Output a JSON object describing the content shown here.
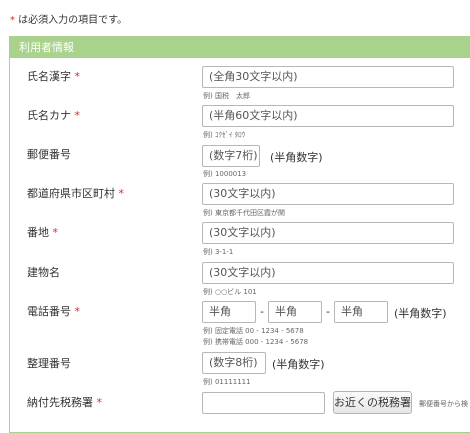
{
  "notice": {
    "asterisk": "*",
    "text": " は必須入力の項目です。"
  },
  "section_title": "利用者情報",
  "required_mark": "*",
  "colors": {
    "header_bg": "#a9d28c",
    "required": "#e0272f"
  },
  "fields": {
    "name_kanji": {
      "label": "氏名漢字",
      "placeholder": "(全角30文字以内)",
      "hint": "例) 国税　太郎"
    },
    "name_kana": {
      "label": "氏名カナ",
      "placeholder": "(半角60文字以内)",
      "hint": "例) ｺｸｾﾞｲ ﾀﾛｳ"
    },
    "postal": {
      "label": "郵便番号",
      "placeholder": "(数字7桁)",
      "suffix": "(半角数字)",
      "hint": "例) 1000013"
    },
    "prefecture_city": {
      "label": "都道府県市区町村",
      "placeholder": "(30文字以内)",
      "hint": "例) 東京都千代田区霞が関"
    },
    "address": {
      "label": "番地",
      "placeholder": "(30文字以内)",
      "hint": "例) 3-1-1"
    },
    "building": {
      "label": "建物名",
      "placeholder": "(30文字以内)",
      "hint": "例) ○○ビル 101"
    },
    "phone": {
      "label": "電話番号",
      "part_placeholder": "半角",
      "separator": "-",
      "suffix": "(半角数字)",
      "hint_1": "例) 固定電話 00 - 1234 - 5678",
      "hint_2": "例) 携帯電話 000 - 1234 - 5678"
    },
    "ref_number": {
      "label": "整理番号",
      "placeholder": "(数字8桁)",
      "suffix": "(半角数字)",
      "hint": "例) 01111111"
    },
    "tax_office": {
      "label": "納付先税務署",
      "button": "お近くの税務署",
      "side_note": "郵便番号から検"
    }
  }
}
